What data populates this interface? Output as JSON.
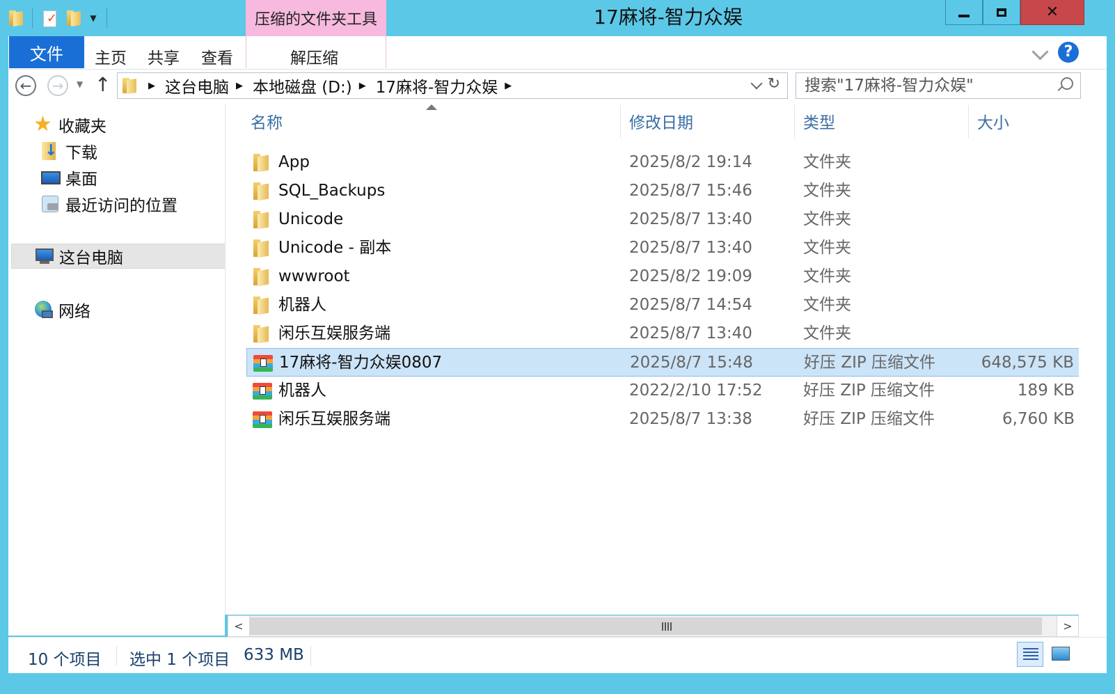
{
  "window": {
    "title": "17麻将-智力众娱",
    "context_tab": "压缩的文件夹工具"
  },
  "ribbon": {
    "file_tab": "文件",
    "tabs": [
      "主页",
      "共享",
      "查看"
    ],
    "context_tab": "解压缩"
  },
  "address": {
    "crumbs": [
      "这台电脑",
      "本地磁盘 (D:)",
      "17麻将-智力众娱"
    ]
  },
  "search": {
    "placeholder": "搜索\"17麻将-智力众娱\""
  },
  "nav": {
    "favorites": "收藏夹",
    "downloads": "下载",
    "desktop": "桌面",
    "recent": "最近访问的位置",
    "this_pc": "这台电脑",
    "network": "网络"
  },
  "columns": {
    "name": "名称",
    "date": "修改日期",
    "type": "类型",
    "size": "大小"
  },
  "files": [
    {
      "name": "App",
      "date": "2025/8/2 19:14",
      "type": "文件夹",
      "size": ""
    },
    {
      "name": "SQL_Backups",
      "date": "2025/8/7 15:46",
      "type": "文件夹",
      "size": ""
    },
    {
      "name": "Unicode",
      "date": "2025/8/7 13:40",
      "type": "文件夹",
      "size": ""
    },
    {
      "name": "Unicode - 副本",
      "date": "2025/8/7 13:40",
      "type": "文件夹",
      "size": ""
    },
    {
      "name": "wwwroot",
      "date": "2025/8/2 19:09",
      "type": "文件夹",
      "size": ""
    },
    {
      "name": "机器人",
      "date": "2025/8/7 14:54",
      "type": "文件夹",
      "size": ""
    },
    {
      "name": "闲乐互娱服务端",
      "date": "2025/8/7 13:40",
      "type": "文件夹",
      "size": ""
    },
    {
      "name": "17麻将-智力众娱0807",
      "date": "2025/8/7 15:48",
      "type": "好压 ZIP 压缩文件",
      "size": "648,575 KB"
    },
    {
      "name": "机器人",
      "date": "2022/2/10 17:52",
      "type": "好压 ZIP 压缩文件",
      "size": "189 KB"
    },
    {
      "name": "闲乐互娱服务端",
      "date": "2025/8/7 13:38",
      "type": "好压 ZIP 压缩文件",
      "size": "6,760 KB"
    }
  ],
  "status": {
    "item_count": "10 个项目",
    "selected": "选中 1 个项目",
    "selected_size": "633 MB"
  }
}
